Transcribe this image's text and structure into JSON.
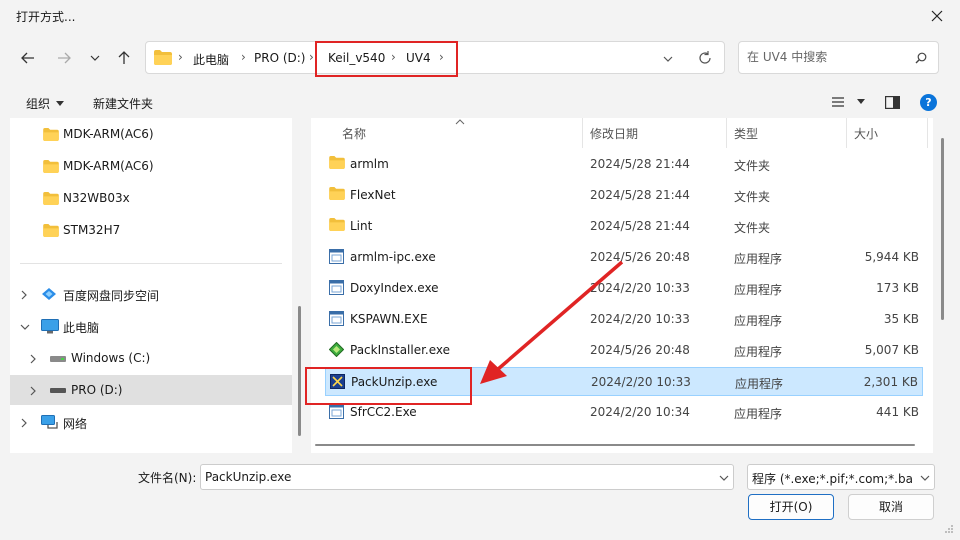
{
  "window": {
    "title": "打开方式..."
  },
  "nav": {
    "breadcrumb": [
      "此电脑",
      "PRO (D:)",
      "Keil_v540",
      "UV4"
    ],
    "search_placeholder": "在 UV4 中搜索"
  },
  "toolbar": {
    "organize": "组织",
    "new_folder": "新建文件夹"
  },
  "sidebar": {
    "items": [
      {
        "label": "MDK-ARM(AC6)",
        "icon": "folder-icon"
      },
      {
        "label": "MDK-ARM(AC6)",
        "icon": "folder-icon"
      },
      {
        "label": "N32WB03x",
        "icon": "folder-icon"
      },
      {
        "label": "STM32H7",
        "icon": "folder-icon"
      },
      {
        "label": "百度网盘同步空间",
        "icon": "cloud-sync-icon"
      },
      {
        "label": "此电脑",
        "icon": "computer-icon"
      },
      {
        "label": "Windows (C:)",
        "icon": "drive-icon"
      },
      {
        "label": "PRO (D:)",
        "icon": "drive-icon",
        "selected": true
      },
      {
        "label": "网络",
        "icon": "network-icon"
      }
    ]
  },
  "file_list": {
    "columns": {
      "name": "名称",
      "modified": "修改日期",
      "type": "类型",
      "size": "大小"
    },
    "rows": [
      {
        "name": "armlm",
        "modified": "2024/5/28 21:44",
        "type": "文件夹",
        "size": "",
        "icon": "folder-icon"
      },
      {
        "name": "FlexNet",
        "modified": "2024/5/28 21:44",
        "type": "文件夹",
        "size": "",
        "icon": "folder-icon"
      },
      {
        "name": "Lint",
        "modified": "2024/5/28 21:44",
        "type": "文件夹",
        "size": "",
        "icon": "folder-icon"
      },
      {
        "name": "armlm-ipc.exe",
        "modified": "2024/5/26 20:48",
        "type": "应用程序",
        "size": "5,944 KB",
        "icon": "exe-icon"
      },
      {
        "name": "DoxyIndex.exe",
        "modified": "2024/2/20 10:33",
        "type": "应用程序",
        "size": "173 KB",
        "icon": "exe-icon"
      },
      {
        "name": "KSPAWN.EXE",
        "modified": "2024/2/20 10:33",
        "type": "应用程序",
        "size": "35 KB",
        "icon": "exe-icon"
      },
      {
        "name": "PackInstaller.exe",
        "modified": "2024/5/26 20:48",
        "type": "应用程序",
        "size": "5,007 KB",
        "icon": "pack-installer-icon"
      },
      {
        "name": "PackUnzip.exe",
        "modified": "2024/2/20 10:33",
        "type": "应用程序",
        "size": "2,301 KB",
        "icon": "pack-unzip-icon",
        "selected": true
      },
      {
        "name": "SfrCC2.Exe",
        "modified": "2024/2/20 10:34",
        "type": "应用程序",
        "size": "441 KB",
        "icon": "exe-icon"
      }
    ]
  },
  "bottom": {
    "filename_label": "文件名(N):",
    "filename_value": "PackUnzip.exe",
    "filter": "程序 (*.exe;*.pif;*.com;*.bat;*.",
    "open_button": "打开(O)",
    "cancel_button": "取消"
  },
  "colors": {
    "accent": "#0067c0",
    "selection": "#cce8ff",
    "annotation": "#e02424"
  }
}
